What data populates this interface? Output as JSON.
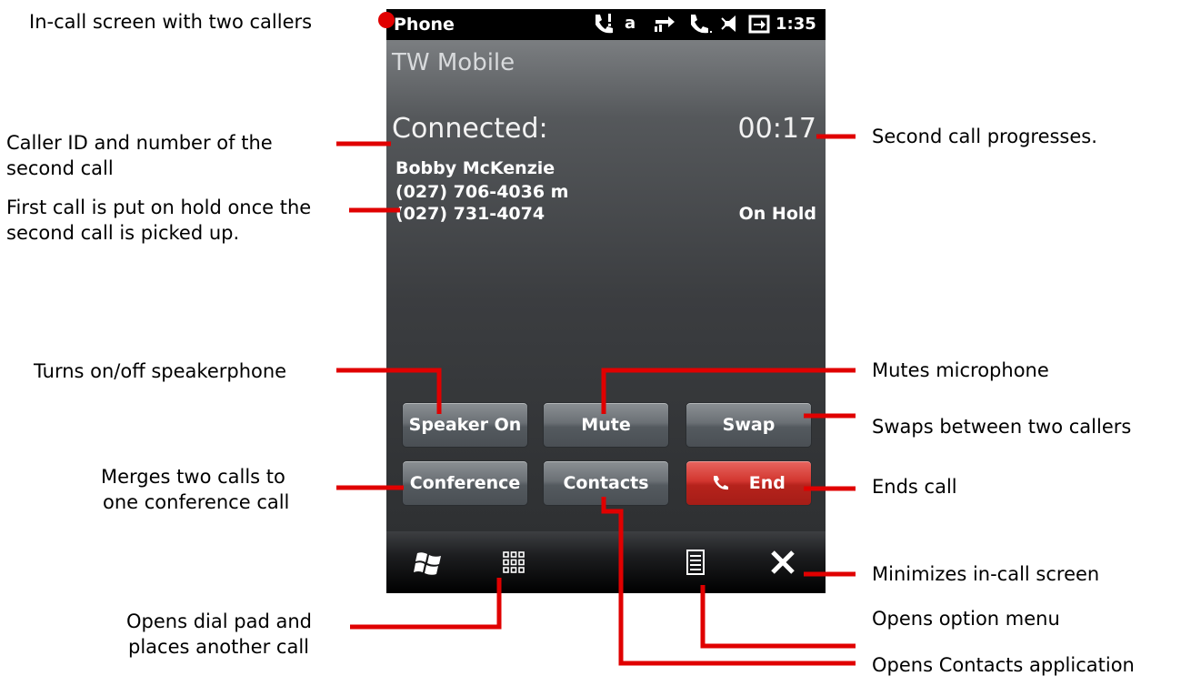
{
  "status_bar": {
    "app_name": "Phone",
    "time": "1:35",
    "icons": [
      "call-signal-icon",
      "a-indicator-icon",
      "data-sync-icon",
      "active-call-icon",
      "speaker-icon",
      "battery-charging-icon"
    ],
    "a_indicator": "a"
  },
  "call_screen": {
    "carrier": "TW Mobile",
    "connected_label": "Connected:",
    "call_timer": "00:17",
    "caller_name": "Bobby McKenzie",
    "caller_number": "(027) 706-4036 m",
    "held_number": "(027) 731-4074",
    "held_status": "On Hold"
  },
  "buttons": {
    "speaker": "Speaker On",
    "mute": "Mute",
    "swap": "Swap",
    "conference": "Conference",
    "contacts": "Contacts",
    "end": "End"
  },
  "taskbar": {
    "icons": [
      "windows-start-icon",
      "dial-pad-icon",
      "option-menu-icon",
      "close-icon"
    ]
  },
  "annotations": {
    "title": "In-call screen with two callers",
    "caller_id_line1": "Caller ID and number of the",
    "caller_id_line2": "second call",
    "hold_line1": "First call is put on hold once the",
    "hold_line2": "second call is picked up.",
    "speaker": "Turns on/off speakerphone",
    "conference_line1": "Merges two calls to",
    "conference_line2": "one conference call",
    "dialpad_line1": "Opens dial pad and",
    "dialpad_line2": "places another call",
    "progress": "Second call progresses.",
    "mute": "Mutes microphone",
    "swap": "Swaps between two callers",
    "end": "Ends call",
    "minimize": "Minimizes in-call screen",
    "option_menu": "Opens option menu",
    "contacts": "Opens Contacts application"
  },
  "colors": {
    "callout_red": "#e00000",
    "end_button_red": "#c62b25",
    "status_bar_bg": "#000000"
  }
}
